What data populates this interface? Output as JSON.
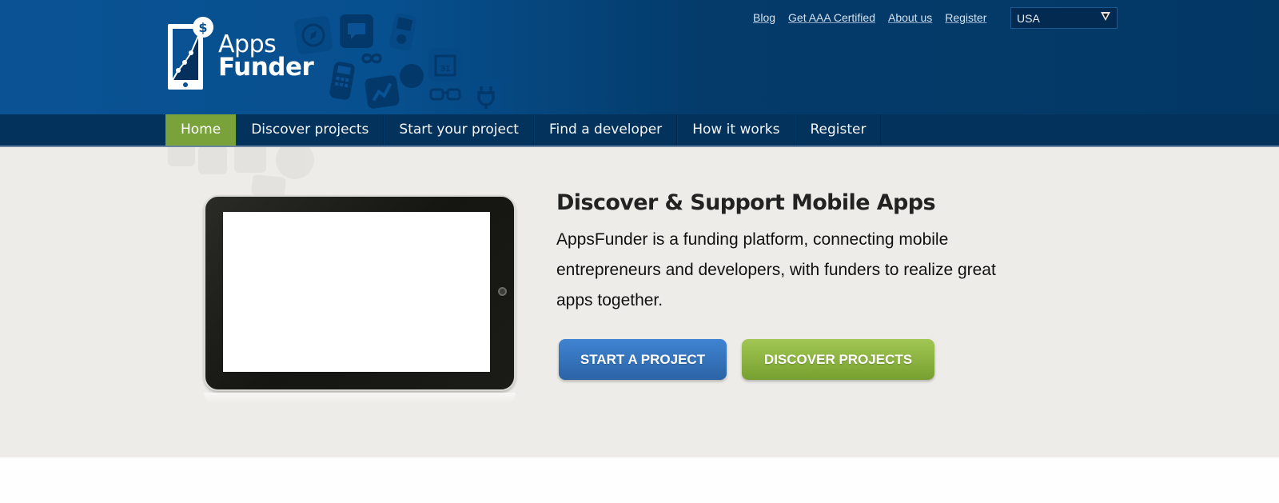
{
  "brand": {
    "logo_line1": "Apps",
    "logo_line2": "Funder",
    "colors": {
      "header_blue": "#07508f",
      "nav_dark": "#03325c",
      "nav_active": "#79a23a",
      "hero_bg": "#eeece8",
      "button_blue": "#3578c4",
      "button_green": "#8bb441"
    }
  },
  "top_links": [
    {
      "label": "Blog"
    },
    {
      "label": "Get AAA Certified"
    },
    {
      "label": "About us"
    },
    {
      "label": "Register"
    }
  ],
  "country_select": {
    "value": "USA",
    "icon": "triangle-down-icon"
  },
  "nav": {
    "items": [
      {
        "label": "Home",
        "active": true
      },
      {
        "label": "Discover projects"
      },
      {
        "label": "Start your project"
      },
      {
        "label": "Find a developer"
      },
      {
        "label": "How it works"
      },
      {
        "label": "Register"
      }
    ]
  },
  "hero": {
    "title": "Discover & Support Mobile Apps",
    "description": "AppsFunder is a funding platform, connecting mobile entrepreneurs and developers, with funders to realize great apps together.",
    "buttons": {
      "start": "START A PROJECT",
      "discover": "DISCOVER PROJECTS"
    }
  }
}
